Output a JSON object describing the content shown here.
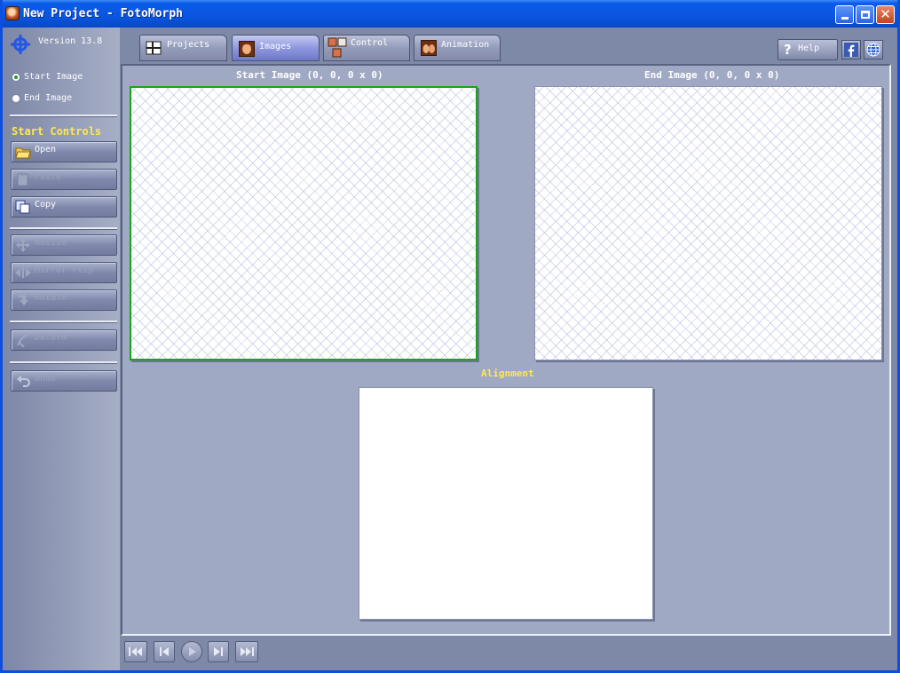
{
  "window": {
    "title": "New Project - FotoMorph",
    "controls": [
      "minimize",
      "maximize",
      "close"
    ]
  },
  "sidebar": {
    "version": "Version 13.8",
    "mode_options": [
      {
        "label": "Start Image",
        "selected": true
      },
      {
        "label": "End Image",
        "selected": false
      }
    ],
    "section_title": "Start Controls",
    "buttons": [
      {
        "label": "Open",
        "enabled": true,
        "icon": "open-folder-icon"
      },
      {
        "label": "Paste",
        "enabled": false,
        "icon": "paste-icon"
      },
      {
        "label": "Copy",
        "enabled": true,
        "icon": "copy-icon"
      },
      {
        "label": "Resize",
        "enabled": false,
        "icon": "resize-icon"
      },
      {
        "label": "Mirror Flip",
        "enabled": false,
        "icon": "mirror-flip-icon"
      },
      {
        "label": "Rotate",
        "enabled": false,
        "icon": "rotate-icon"
      },
      {
        "label": "Deform",
        "enabled": false,
        "icon": "deform-icon"
      },
      {
        "label": "Undo",
        "enabled": false,
        "icon": "undo-icon"
      }
    ]
  },
  "tabs": [
    {
      "label": "Projects",
      "active": false,
      "icon": "grid-icon"
    },
    {
      "label": "Images",
      "active": true,
      "icon": "portrait-icon"
    },
    {
      "label": "Control",
      "active": false,
      "icon": "control-icon"
    },
    {
      "label": "Animation",
      "active": false,
      "icon": "animation-icon"
    }
  ],
  "toolbar": {
    "help_label": "Help",
    "facebook_icon": "facebook-icon",
    "web_icon": "globe-icon"
  },
  "panels": {
    "start_title": "Start Image (0, 0, 0 x 0)",
    "end_title": "End Image (0, 0, 0 x 0)",
    "alignment_title": "Alignment"
  },
  "playback": [
    "first-frame",
    "previous-frame",
    "play",
    "next-frame",
    "last-frame"
  ],
  "colors": {
    "title_accent": "#ffe94a",
    "selected_frame": "#1aa31a",
    "titlebar": "#0a55e0"
  }
}
